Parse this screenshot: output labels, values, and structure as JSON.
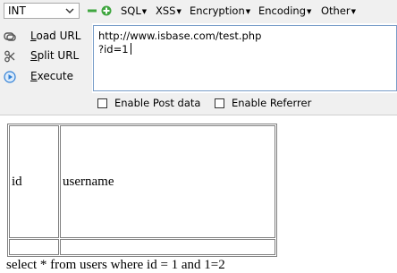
{
  "toolbar": {
    "type_select": {
      "value": "INT"
    },
    "menus": [
      {
        "label": "SQL"
      },
      {
        "label": "XSS"
      },
      {
        "label": "Encryption"
      },
      {
        "label": "Encoding"
      },
      {
        "label": "Other"
      }
    ]
  },
  "actions": [
    {
      "label": "Load URL",
      "icon": "load-url-icon"
    },
    {
      "label": "Split URL",
      "icon": "split-url-icon"
    },
    {
      "label": "Execute",
      "icon": "execute-icon"
    }
  ],
  "url": {
    "line1": "http://www.isbase.com/test.php",
    "line2": "?id=1"
  },
  "options": {
    "post_data": {
      "label": "Enable Post data",
      "checked": false
    },
    "referrer": {
      "label": "Enable Referrer",
      "checked": false
    }
  },
  "result": {
    "headers": [
      "id",
      "username"
    ],
    "rows": [
      [
        "",
        ""
      ]
    ],
    "query_text": "select * from users where id = 1 and 1=2"
  },
  "colors": {
    "chrome_bg": "#f0f0f0",
    "url_border": "#7a9ec9",
    "minus_icon": "#3fa63f",
    "plus_icon": "#3fa63f",
    "execute_icon": "#2f7fd6"
  }
}
